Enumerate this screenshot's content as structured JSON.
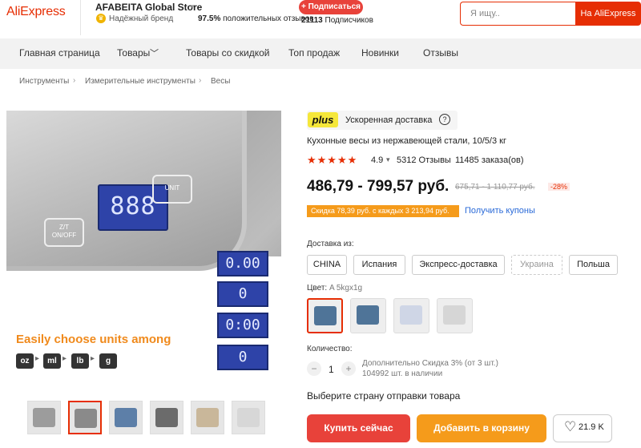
{
  "header": {
    "logo": "AliExpress",
    "store_name": "AFABEITA Global Store",
    "store_caret_icon": "caret-down-icon",
    "brand_badge_icon": "trophy-icon",
    "brand_label": "Надёжный бренд",
    "positive_pct": "97.5%",
    "positive_label": "положительных отзывов",
    "subscribe_label": "+ Подписаться",
    "subscribers_count": "21113",
    "subscribers_label": "Подписчиков",
    "search_placeholder": "Я ищу..",
    "search_button": "На AliExpress"
  },
  "nav": {
    "items": [
      "Главная страница",
      "Товары",
      "Товары со скидкой",
      "Топ продаж",
      "Новинки",
      "Отзывы"
    ],
    "goods_caret_icon": "chevron-down-icon"
  },
  "breadcrumb": [
    "Инструменты",
    "Измерительные инструменты",
    "Весы"
  ],
  "gallery": {
    "display_main": "888",
    "button_zt": "Z/T",
    "button_onoff": "ON/OFF",
    "button_unit": "UNIT",
    "mini_displays": [
      "0.00",
      "0",
      "0:00",
      "0"
    ],
    "units_text": "Easily choose units among",
    "units": [
      "oz",
      "ml",
      "lb",
      "g"
    ],
    "thumbnail_count": 6
  },
  "product": {
    "plus_logo": "plus",
    "fast_delivery": "Ускоренная доставка",
    "help_icon": "question-icon",
    "title": "Кухонные весы из нержавеющей стали, 10/5/3 кг",
    "stars": "★★★★★",
    "rating": "4.9",
    "reviews": "5312 Отзывы",
    "orders": "11485 заказа(ов)",
    "price": "486,79 - 799,57 руб.",
    "old_price": "675,71 - 1 110,77 руб.",
    "discount": "-28%",
    "coupon_text": "Скидка 78,39 руб. с каждых 3 213,94 руб.",
    "get_coupons": "Получить купоны",
    "ship_from_label": "Доставка из:",
    "ship_from_options": [
      "CHINA",
      "Испания",
      "Экспресс-доставка",
      "Украина",
      "Польша"
    ],
    "color_label": "Цвет:",
    "color_value": "A 5kgx1g",
    "quantity_label": "Количество:",
    "quantity_value": "1",
    "qty_minus": "−",
    "qty_plus": "+",
    "extra_discount": "Дополнительно Скидка 3% (от 3 шт.)",
    "stock": "104992 шт. в наличии",
    "select_country": "Выберите страну отправки товара",
    "buy_now": "Купить сейчас",
    "add_to_cart": "Добавить в корзину",
    "wishlist_icon": "heart-icon",
    "wishlist_count": "21.9 K"
  },
  "colors": {
    "brand": "#e62e04",
    "buy": "#e8423a",
    "cart": "#f59b1b",
    "link": "#2a6ad8"
  }
}
